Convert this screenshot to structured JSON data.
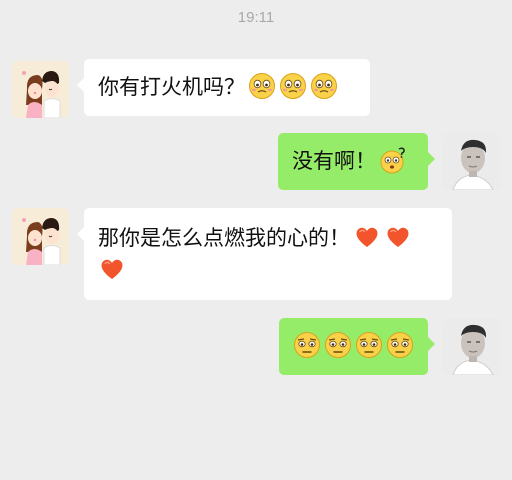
{
  "chat": {
    "timestamp": "19:11",
    "messages": [
      {
        "from": "contact",
        "text": "你有打火机吗？",
        "emojis": [
          "sweat-face-icon",
          "sweat-face-icon",
          "sweat-face-icon"
        ]
      },
      {
        "from": "me",
        "text": "没有啊！",
        "emojis": [
          "confused-question-face-icon"
        ]
      },
      {
        "from": "contact",
        "text": "那你是怎么点燃我的心的！",
        "emojis": [
          "red-heart-icon",
          "red-heart-icon",
          "red-heart-icon"
        ]
      },
      {
        "from": "me",
        "text": "",
        "emojis": [
          "worried-face-icon",
          "worried-face-icon",
          "worried-face-icon",
          "worried-face-icon"
        ]
      }
    ]
  },
  "colors": {
    "background": "#ededed",
    "incoming_bubble": "#ffffff",
    "outgoing_bubble": "#95ec69",
    "timestamp": "#a9a9a9"
  }
}
